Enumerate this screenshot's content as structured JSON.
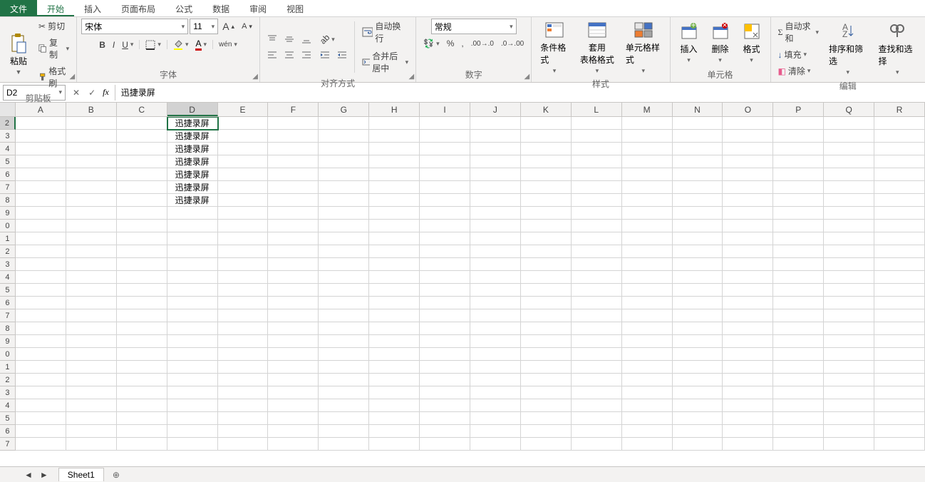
{
  "tabs": {
    "file": "文件",
    "items": [
      "开始",
      "插入",
      "页面布局",
      "公式",
      "数据",
      "审阅",
      "视图"
    ],
    "active": 0
  },
  "ribbon": {
    "clipboard": {
      "label": "剪贴板",
      "paste": "粘贴",
      "cut": "剪切",
      "copy": "复制",
      "format_painter": "格式刷"
    },
    "font": {
      "label": "字体",
      "name": "宋体",
      "size": "11",
      "pinyin": "wén"
    },
    "alignment": {
      "label": "对齐方式",
      "wrap": "自动换行",
      "merge": "合并后居中"
    },
    "number": {
      "label": "数字",
      "format": "常规"
    },
    "styles": {
      "label": "样式",
      "conditional": "条件格式",
      "table": "套用\n表格格式",
      "cell": "单元格样式"
    },
    "cells": {
      "label": "单元格",
      "insert": "插入",
      "delete": "删除",
      "format": "格式"
    },
    "editing": {
      "label": "编辑",
      "sum": "自动求和",
      "fill": "填充",
      "clear": "清除",
      "sort": "排序和筛选",
      "find": "查找和选择"
    }
  },
  "name_box": "D2",
  "formula": "迅捷录屏",
  "columns": [
    "A",
    "B",
    "C",
    "D",
    "E",
    "F",
    "G",
    "H",
    "I",
    "J",
    "K",
    "L",
    "M",
    "N",
    "O",
    "P",
    "Q",
    "R"
  ],
  "active_col": 3,
  "active_row": 0,
  "cells": {
    "D2": "迅捷录屏",
    "D3": "迅捷录屏",
    "D4": "迅捷录屏",
    "D5": "迅捷录屏",
    "D6": "迅捷录屏",
    "D7": "迅捷录屏",
    "D8": "迅捷录屏"
  },
  "row_labels": [
    "2",
    "3",
    "4",
    "5",
    "6",
    "7",
    "8",
    "9",
    "0",
    "1",
    "2",
    "3",
    "4",
    "5",
    "6",
    "7",
    "8",
    "9",
    "0",
    "1",
    "2",
    "3",
    "4",
    "5",
    "6",
    "7"
  ],
  "sheet": {
    "name": "Sheet1"
  }
}
